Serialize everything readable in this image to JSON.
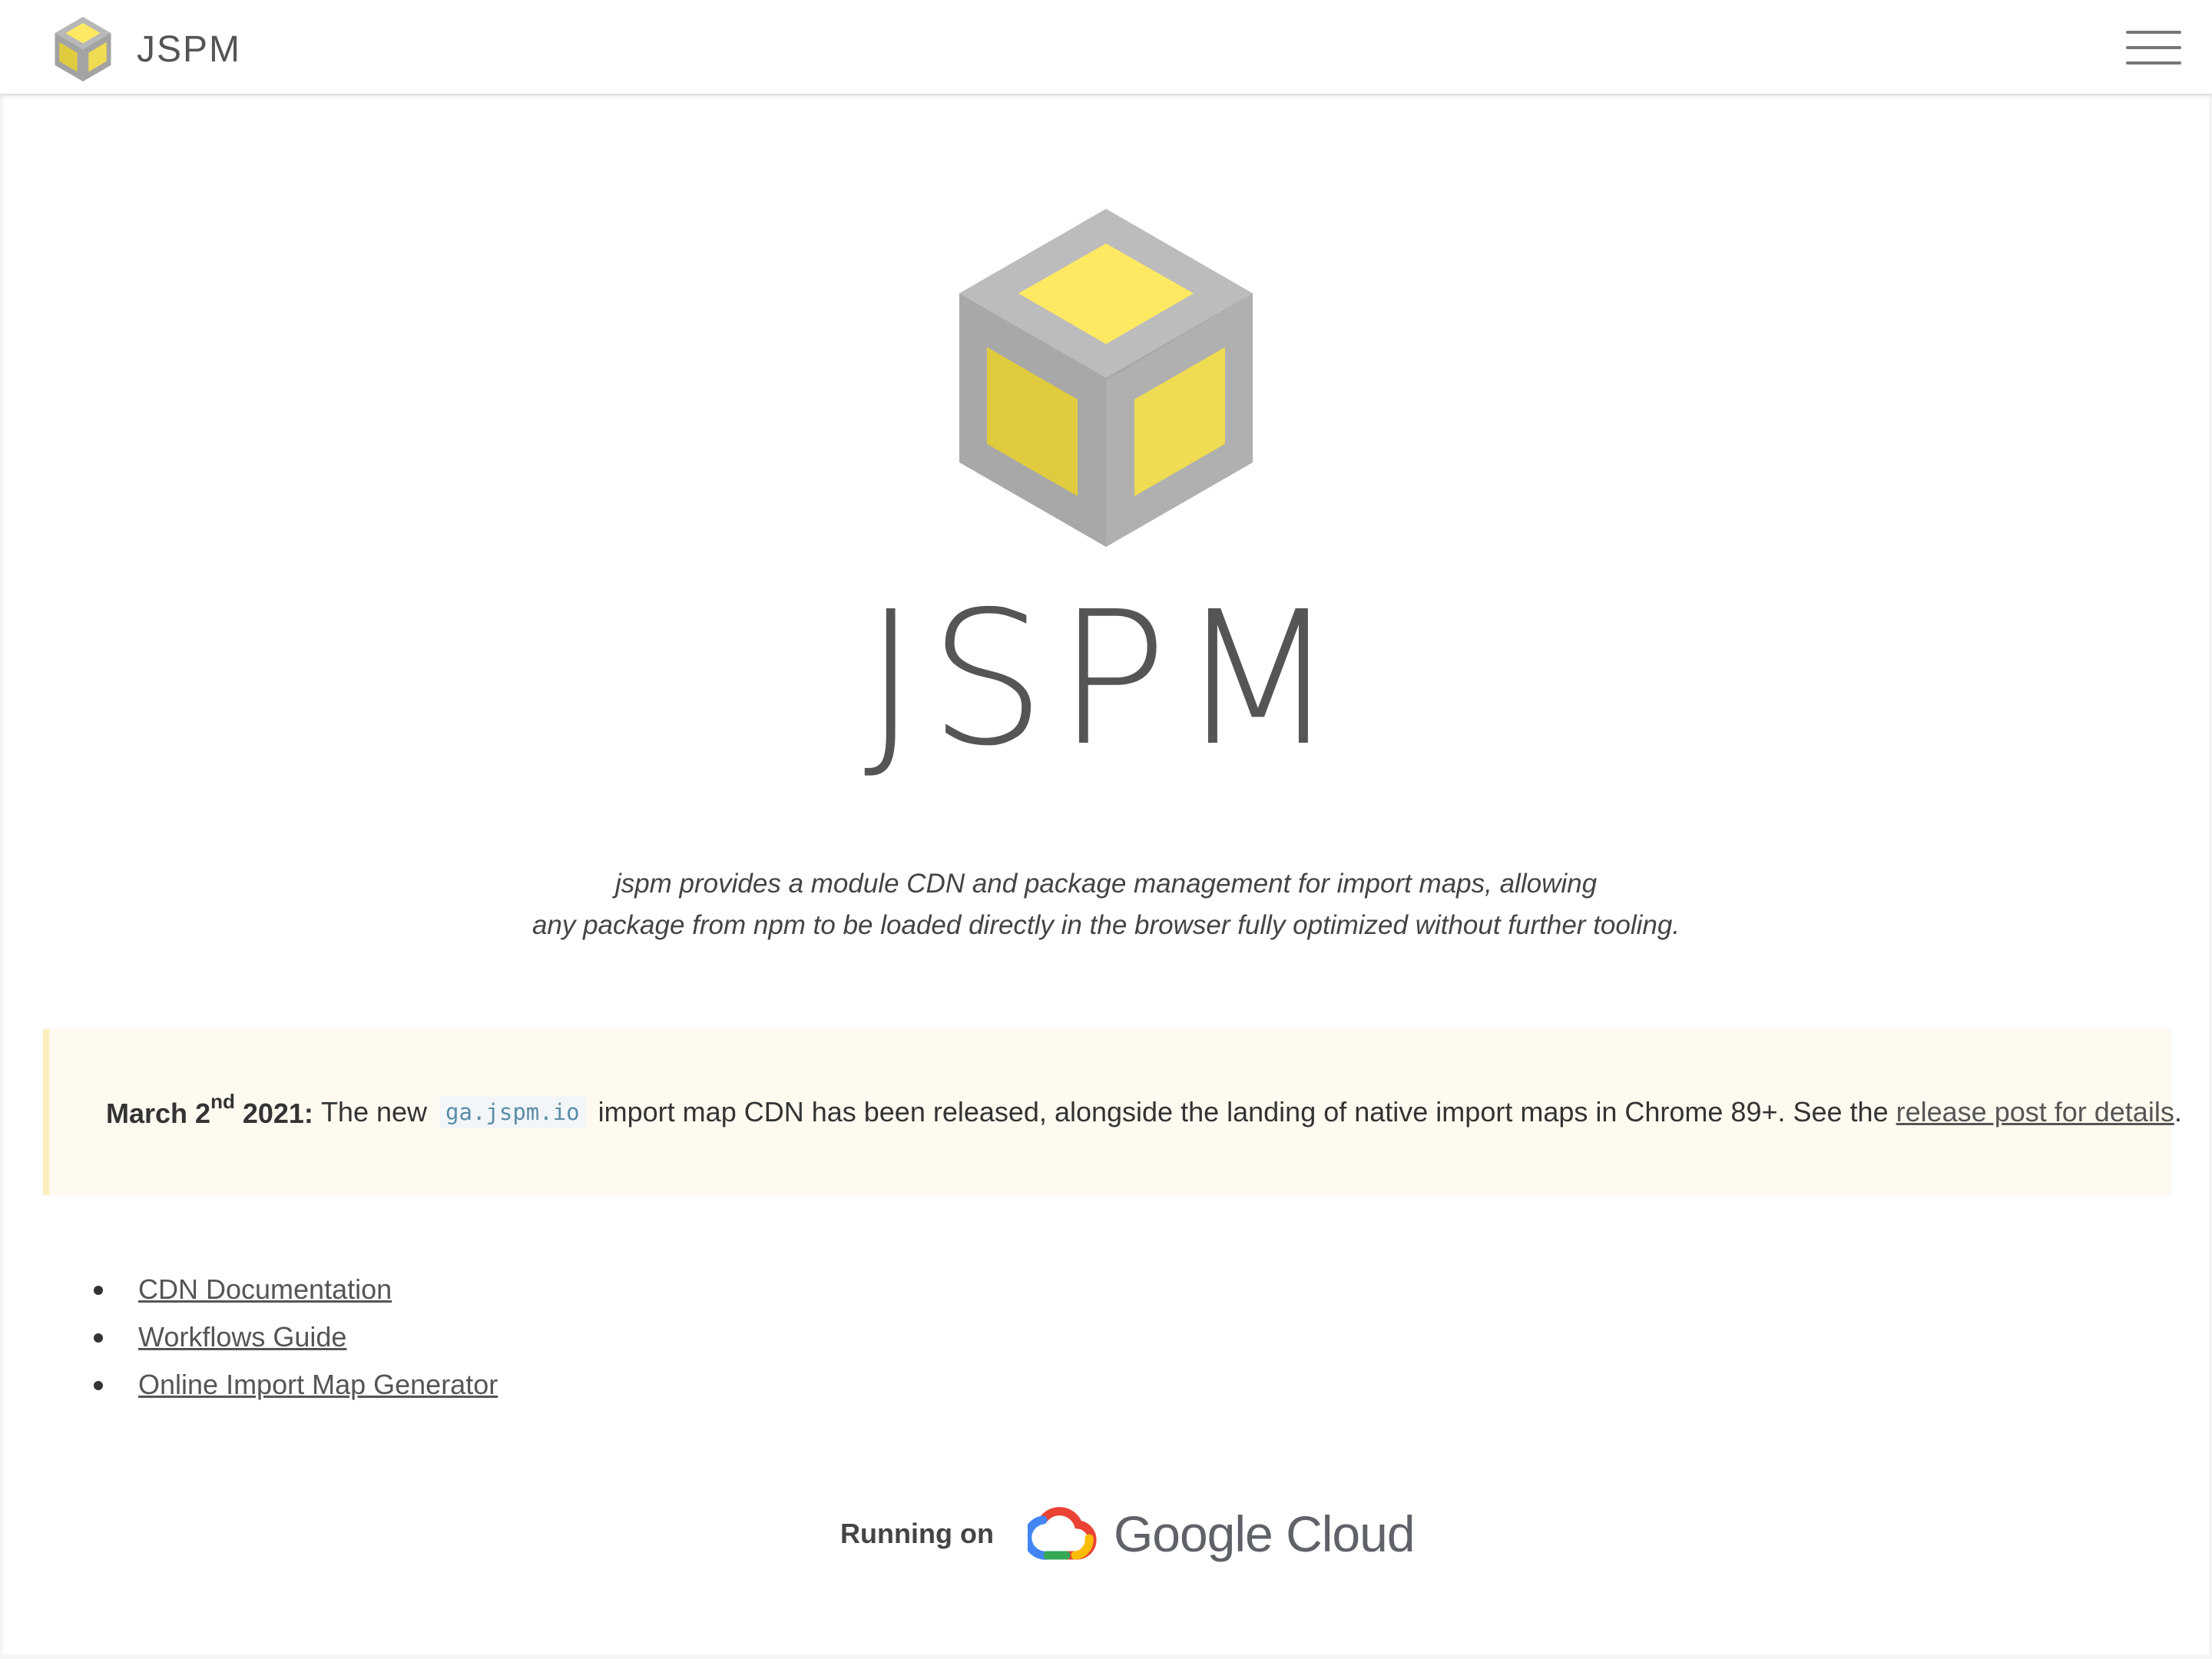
{
  "header": {
    "brand_name": "JSPM",
    "logo_icon": "jspm-cube-icon",
    "menu_icon": "hamburger-menu-icon"
  },
  "hero": {
    "title": "JSPM",
    "tagline_line1": "jspm provides a module CDN and package management for import maps, allowing",
    "tagline_line2": "any package from npm to be loaded directly in the browser fully optimized without further tooling."
  },
  "notice": {
    "date_prefix": "March 2",
    "date_suffix": "nd",
    "date_year": "2021:",
    "text_before_code": "The new",
    "code": "ga.jspm.io",
    "text_after_code": "import map CDN has been released, alongside the landing of native import maps in Chrome 89+. See the",
    "link_label": "release post for details",
    "text_end": "."
  },
  "links": [
    {
      "label": "CDN Documentation"
    },
    {
      "label": "Workflows Guide"
    },
    {
      "label": "Online Import Map Generator"
    }
  ],
  "footer": {
    "running_on": "Running on",
    "provider": "Google Cloud",
    "provider_icon": "google-cloud-icon"
  },
  "colors": {
    "cube_gray": "#b3b3b3",
    "cube_yellow_top": "#ffe963",
    "cube_yellow_left": "#e0cb3e",
    "cube_yellow_right": "#efdc52",
    "notice_bg": "#fffaf0",
    "notice_border": "#fbefc0",
    "code_color": "#5a8ca8"
  }
}
